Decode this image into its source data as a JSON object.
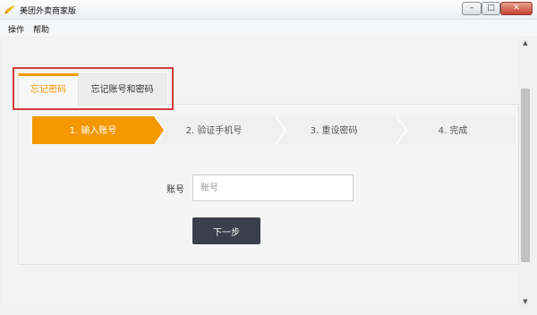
{
  "window": {
    "title": "美团外卖商家版",
    "minimize_glyph": "–",
    "maximize_glyph": "□",
    "close_glyph": "✕",
    "app_icon": "pencil-logo-icon",
    "brand_color": "#f39800"
  },
  "menubar": {
    "items": [
      {
        "label": "操作"
      },
      {
        "label": "帮助"
      }
    ]
  },
  "tabs": [
    {
      "label": "忘记密码",
      "active": true
    },
    {
      "label": "忘记账号和密码",
      "active": false
    }
  ],
  "steps": [
    {
      "label": "1. 输入账号",
      "active": true
    },
    {
      "label": "2. 验证手机号",
      "active": false
    },
    {
      "label": "3. 重设密码",
      "active": false
    },
    {
      "label": "4. 完成",
      "active": false
    }
  ],
  "form": {
    "account_label": "账号",
    "account_placeholder": "账号",
    "account_value": "",
    "next_label": "下一步"
  },
  "colors": {
    "active_step": "#f39800",
    "inactive_step": "#f0f0f0",
    "button": "#3b3e4c",
    "highlight": "#d33b3b"
  }
}
